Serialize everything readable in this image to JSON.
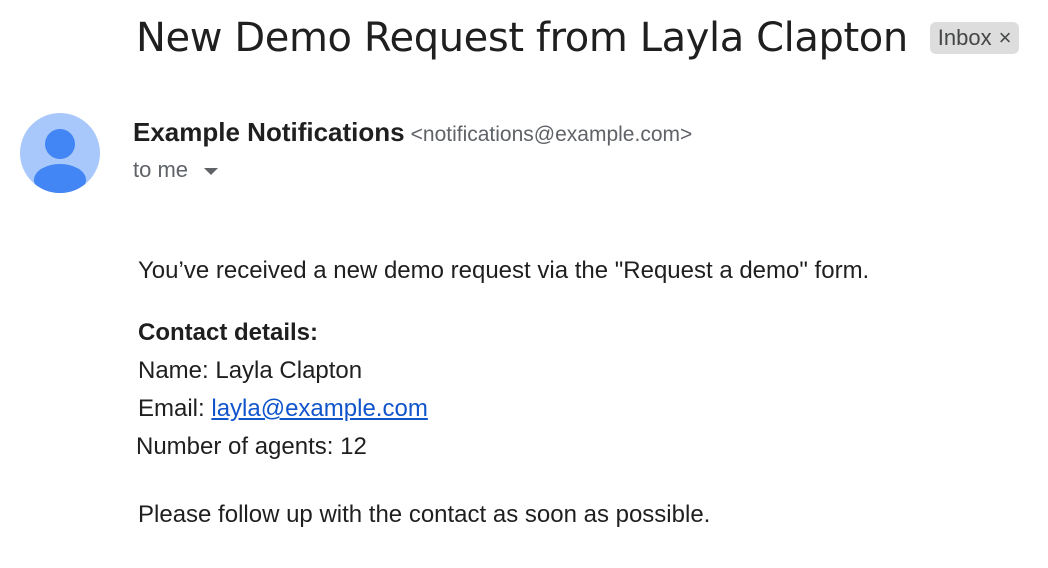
{
  "email": {
    "subject": "New Demo Request from Layla Clapton",
    "label": {
      "text": "Inbox",
      "remove_glyph": "×"
    },
    "sender": {
      "name": "Example Notifications",
      "address": "<notifications@example.com>",
      "avatar_icon": "person-icon",
      "avatar_bg": "#a8c7fa",
      "avatar_fg": "#4285f4"
    },
    "recipient": {
      "text": "to me",
      "toggle_icon": "caret-down-icon"
    },
    "body": {
      "intro": "You’ve received a new demo request via the \"Request a demo\" form.",
      "details_heading": "Contact details:",
      "name_line": "Name: Layla Clapton",
      "email_prefix": "Email: ",
      "email_link": "layla@example.com",
      "agents_line": "Number of agents: 12",
      "closing": "Please follow up with the contact as soon as possible."
    },
    "colors": {
      "link": "#1155cc",
      "chip_bg": "#dddddd"
    }
  }
}
